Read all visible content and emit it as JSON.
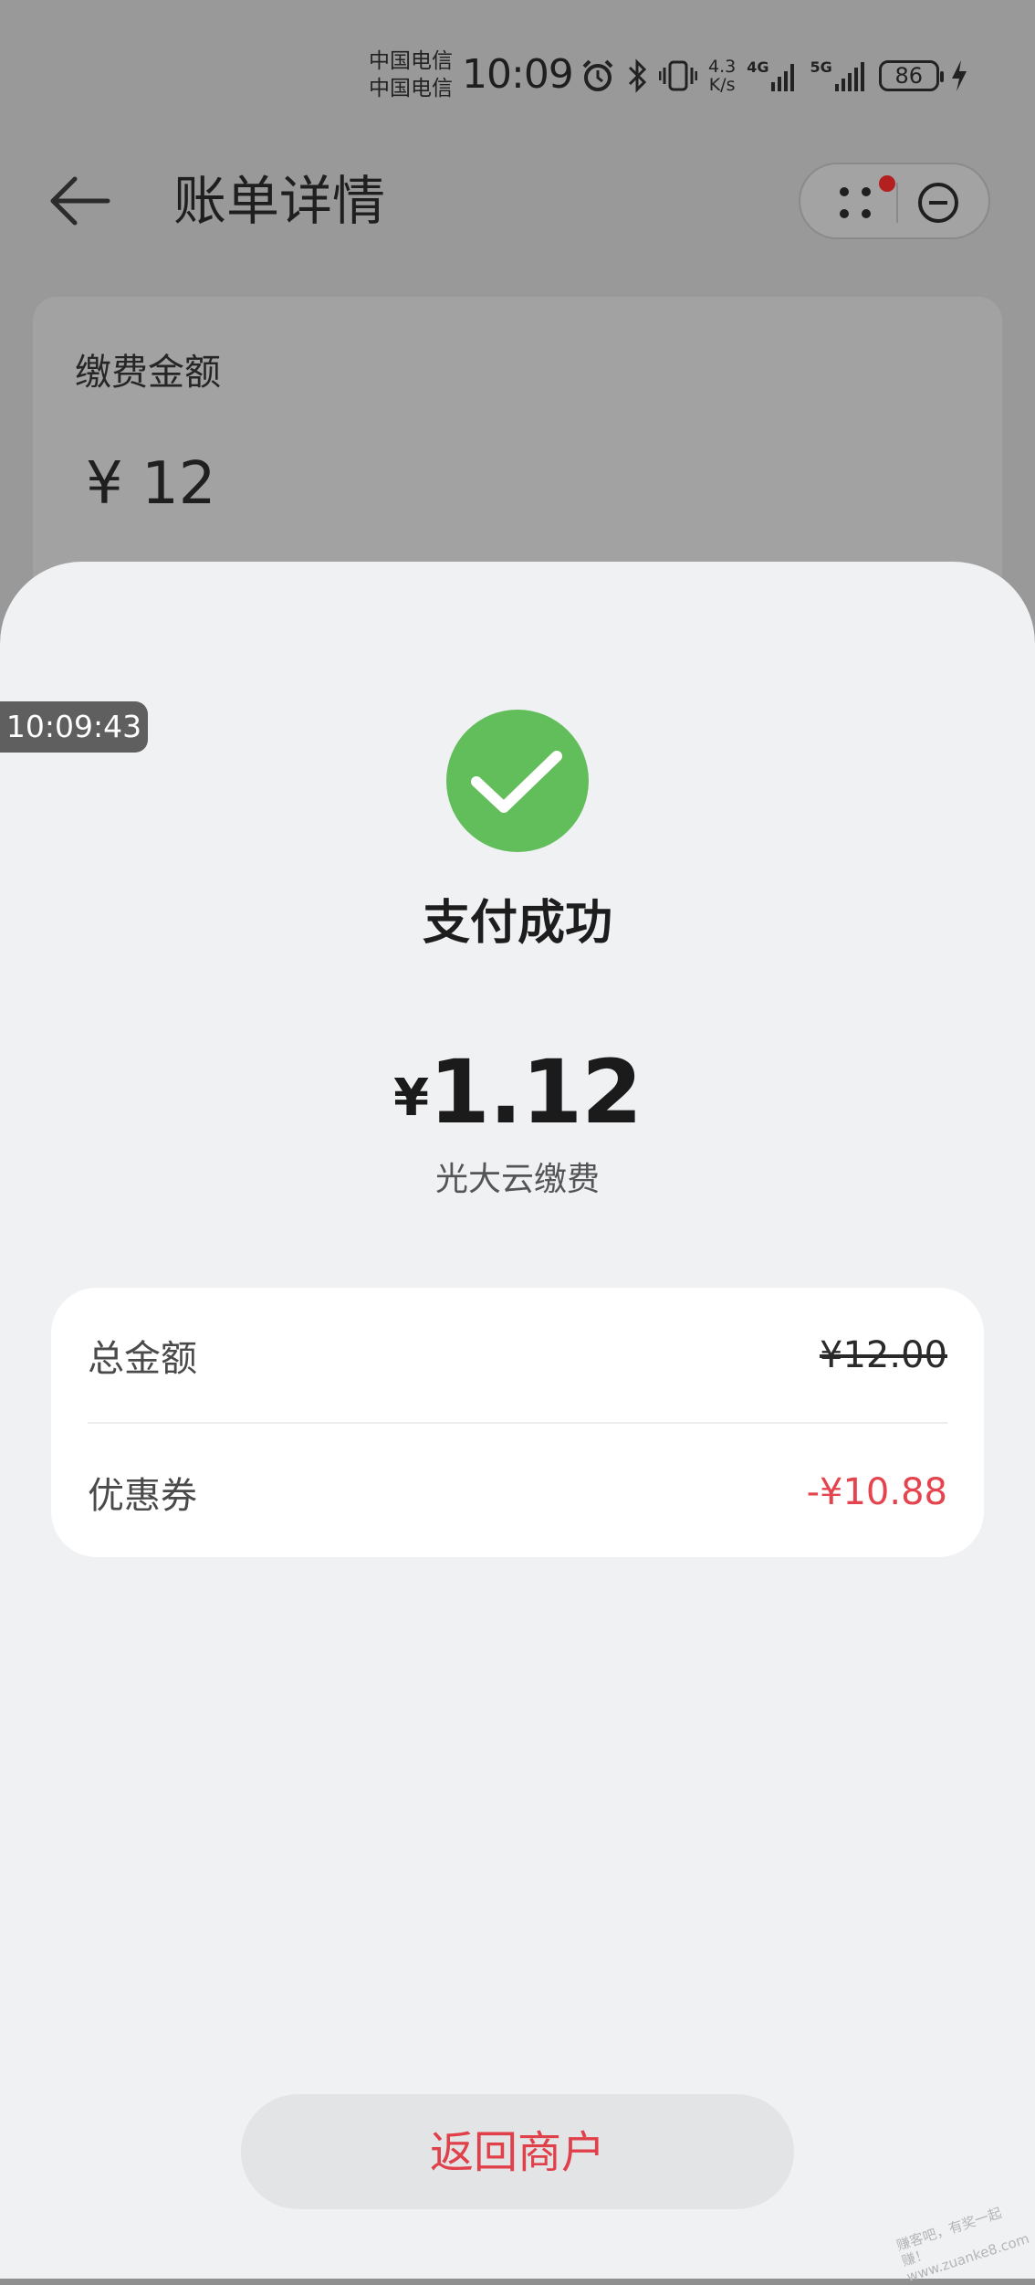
{
  "status_bar": {
    "carrier_line1": "中国电信",
    "carrier_line2": "中国电信",
    "time": "10:09",
    "net_speed_value": "4.3",
    "net_speed_unit": "K/s",
    "signal1_label": "4G",
    "signal2_label": "5G",
    "battery": "86",
    "icons": [
      "alarm-icon",
      "bluetooth-icon",
      "vibrate-icon",
      "signal-icon",
      "signal-icon",
      "battery-icon",
      "charging-icon"
    ]
  },
  "nav": {
    "title": "账单详情",
    "icons": [
      "back-arrow-icon",
      "more-dots-icon",
      "close-circle-icon"
    ]
  },
  "bill_card": {
    "label": "缴费金额",
    "amount": "¥  12"
  },
  "overlay": {
    "timestamp": "10:09:43"
  },
  "payment": {
    "status": "支付成功",
    "currency": "¥",
    "amount": "1.12",
    "merchant": "光大云缴费",
    "details": [
      {
        "label": "总金额",
        "value": "¥12.00"
      },
      {
        "label": "优惠券",
        "value": "-¥10.88"
      }
    ],
    "return_button": "返回商户"
  },
  "watermark": "赚客吧，有奖一起赚！ www.zuanke8.com",
  "colors": {
    "success_green": "#62bd5b",
    "accent_red": "#e5444e",
    "sheet_bg": "#f0f1f3"
  }
}
